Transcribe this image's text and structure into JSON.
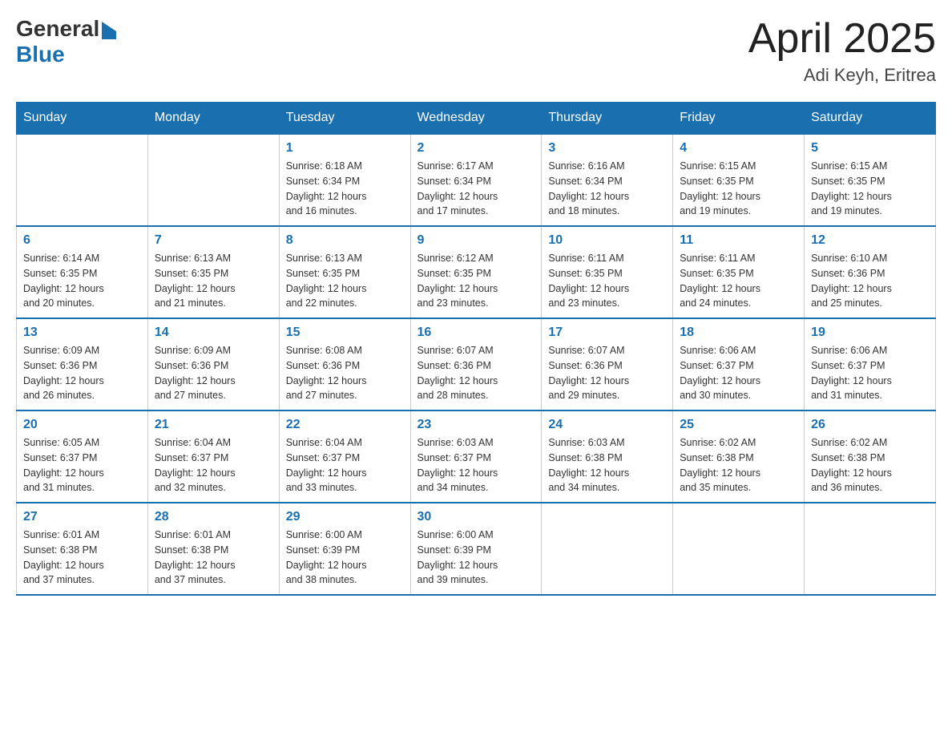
{
  "header": {
    "logo_general": "General",
    "logo_blue": "Blue",
    "month_title": "April 2025",
    "location": "Adi Keyh, Eritrea"
  },
  "calendar": {
    "days_of_week": [
      "Sunday",
      "Monday",
      "Tuesday",
      "Wednesday",
      "Thursday",
      "Friday",
      "Saturday"
    ],
    "weeks": [
      [
        {
          "day": "",
          "info": ""
        },
        {
          "day": "",
          "info": ""
        },
        {
          "day": "1",
          "info": "Sunrise: 6:18 AM\nSunset: 6:34 PM\nDaylight: 12 hours\nand 16 minutes."
        },
        {
          "day": "2",
          "info": "Sunrise: 6:17 AM\nSunset: 6:34 PM\nDaylight: 12 hours\nand 17 minutes."
        },
        {
          "day": "3",
          "info": "Sunrise: 6:16 AM\nSunset: 6:34 PM\nDaylight: 12 hours\nand 18 minutes."
        },
        {
          "day": "4",
          "info": "Sunrise: 6:15 AM\nSunset: 6:35 PM\nDaylight: 12 hours\nand 19 minutes."
        },
        {
          "day": "5",
          "info": "Sunrise: 6:15 AM\nSunset: 6:35 PM\nDaylight: 12 hours\nand 19 minutes."
        }
      ],
      [
        {
          "day": "6",
          "info": "Sunrise: 6:14 AM\nSunset: 6:35 PM\nDaylight: 12 hours\nand 20 minutes."
        },
        {
          "day": "7",
          "info": "Sunrise: 6:13 AM\nSunset: 6:35 PM\nDaylight: 12 hours\nand 21 minutes."
        },
        {
          "day": "8",
          "info": "Sunrise: 6:13 AM\nSunset: 6:35 PM\nDaylight: 12 hours\nand 22 minutes."
        },
        {
          "day": "9",
          "info": "Sunrise: 6:12 AM\nSunset: 6:35 PM\nDaylight: 12 hours\nand 23 minutes."
        },
        {
          "day": "10",
          "info": "Sunrise: 6:11 AM\nSunset: 6:35 PM\nDaylight: 12 hours\nand 23 minutes."
        },
        {
          "day": "11",
          "info": "Sunrise: 6:11 AM\nSunset: 6:35 PM\nDaylight: 12 hours\nand 24 minutes."
        },
        {
          "day": "12",
          "info": "Sunrise: 6:10 AM\nSunset: 6:36 PM\nDaylight: 12 hours\nand 25 minutes."
        }
      ],
      [
        {
          "day": "13",
          "info": "Sunrise: 6:09 AM\nSunset: 6:36 PM\nDaylight: 12 hours\nand 26 minutes."
        },
        {
          "day": "14",
          "info": "Sunrise: 6:09 AM\nSunset: 6:36 PM\nDaylight: 12 hours\nand 27 minutes."
        },
        {
          "day": "15",
          "info": "Sunrise: 6:08 AM\nSunset: 6:36 PM\nDaylight: 12 hours\nand 27 minutes."
        },
        {
          "day": "16",
          "info": "Sunrise: 6:07 AM\nSunset: 6:36 PM\nDaylight: 12 hours\nand 28 minutes."
        },
        {
          "day": "17",
          "info": "Sunrise: 6:07 AM\nSunset: 6:36 PM\nDaylight: 12 hours\nand 29 minutes."
        },
        {
          "day": "18",
          "info": "Sunrise: 6:06 AM\nSunset: 6:37 PM\nDaylight: 12 hours\nand 30 minutes."
        },
        {
          "day": "19",
          "info": "Sunrise: 6:06 AM\nSunset: 6:37 PM\nDaylight: 12 hours\nand 31 minutes."
        }
      ],
      [
        {
          "day": "20",
          "info": "Sunrise: 6:05 AM\nSunset: 6:37 PM\nDaylight: 12 hours\nand 31 minutes."
        },
        {
          "day": "21",
          "info": "Sunrise: 6:04 AM\nSunset: 6:37 PM\nDaylight: 12 hours\nand 32 minutes."
        },
        {
          "day": "22",
          "info": "Sunrise: 6:04 AM\nSunset: 6:37 PM\nDaylight: 12 hours\nand 33 minutes."
        },
        {
          "day": "23",
          "info": "Sunrise: 6:03 AM\nSunset: 6:37 PM\nDaylight: 12 hours\nand 34 minutes."
        },
        {
          "day": "24",
          "info": "Sunrise: 6:03 AM\nSunset: 6:38 PM\nDaylight: 12 hours\nand 34 minutes."
        },
        {
          "day": "25",
          "info": "Sunrise: 6:02 AM\nSunset: 6:38 PM\nDaylight: 12 hours\nand 35 minutes."
        },
        {
          "day": "26",
          "info": "Sunrise: 6:02 AM\nSunset: 6:38 PM\nDaylight: 12 hours\nand 36 minutes."
        }
      ],
      [
        {
          "day": "27",
          "info": "Sunrise: 6:01 AM\nSunset: 6:38 PM\nDaylight: 12 hours\nand 37 minutes."
        },
        {
          "day": "28",
          "info": "Sunrise: 6:01 AM\nSunset: 6:38 PM\nDaylight: 12 hours\nand 37 minutes."
        },
        {
          "day": "29",
          "info": "Sunrise: 6:00 AM\nSunset: 6:39 PM\nDaylight: 12 hours\nand 38 minutes."
        },
        {
          "day": "30",
          "info": "Sunrise: 6:00 AM\nSunset: 6:39 PM\nDaylight: 12 hours\nand 39 minutes."
        },
        {
          "day": "",
          "info": ""
        },
        {
          "day": "",
          "info": ""
        },
        {
          "day": "",
          "info": ""
        }
      ]
    ]
  }
}
